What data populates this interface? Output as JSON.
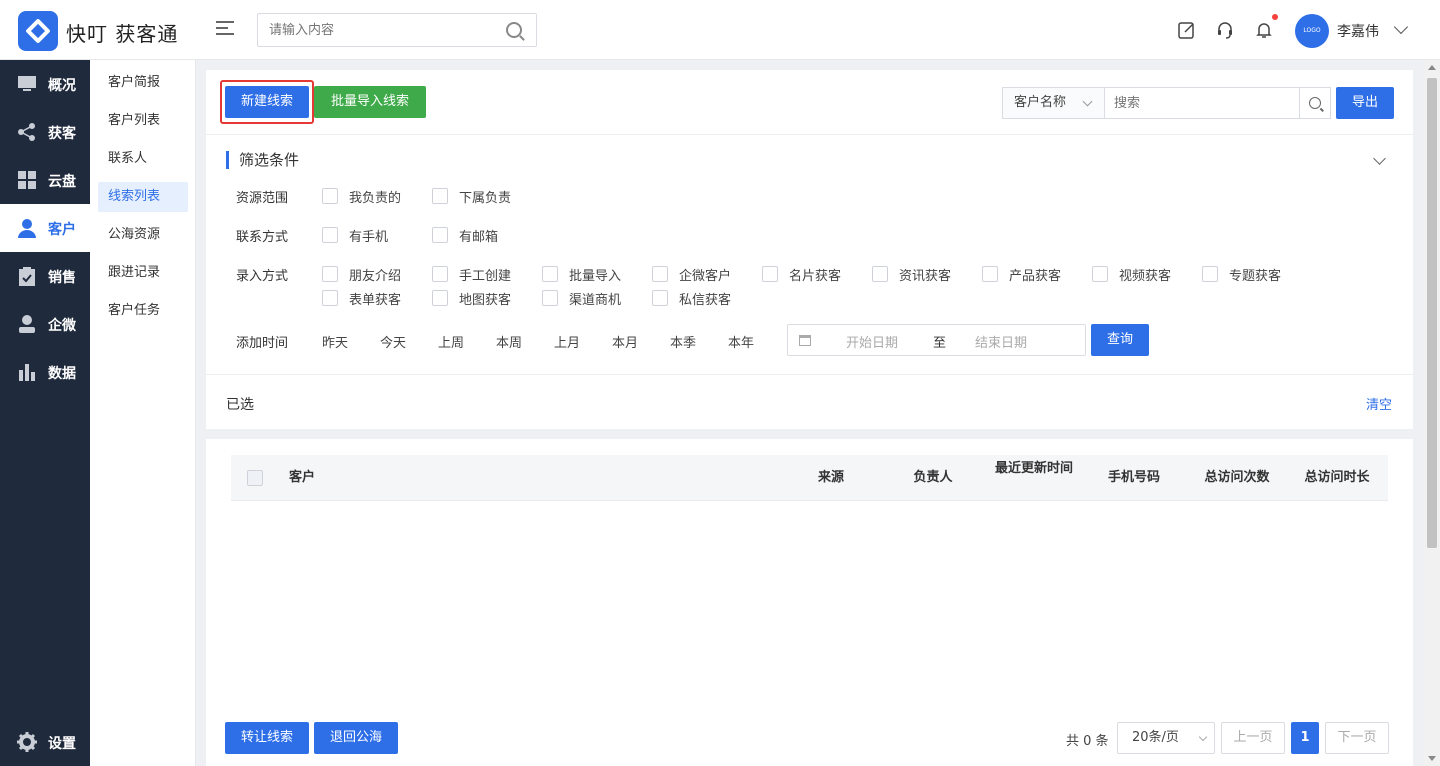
{
  "app": {
    "title": "快叮 获客通"
  },
  "header": {
    "search_placeholder": "请输入内容",
    "avatar_text": "LOGO",
    "username": "李嘉伟"
  },
  "nav": {
    "items": [
      {
        "label": "概况",
        "icon": "monitor-icon"
      },
      {
        "label": "获客",
        "icon": "share-icon"
      },
      {
        "label": "云盘",
        "icon": "grid-icon"
      },
      {
        "label": "客户",
        "icon": "user-icon",
        "active": true
      },
      {
        "label": "销售",
        "icon": "clipboard-check-icon"
      },
      {
        "label": "企微",
        "icon": "person-icon"
      },
      {
        "label": "数据",
        "icon": "bar-chart-icon"
      }
    ],
    "settings_label": "设置"
  },
  "subnav": {
    "items": [
      "客户简报",
      "客户列表",
      "联系人",
      "线索列表",
      "公海资源",
      "跟进记录",
      "客户任务"
    ],
    "active_index": 3
  },
  "toolbar": {
    "new_lead": "新建线索",
    "bulk_import": "批量导入线索",
    "field_select": "客户名称",
    "search_placeholder": "搜索",
    "export": "导出"
  },
  "filters": {
    "title": "筛选条件",
    "scope_label": "资源范围",
    "scope_options": [
      "我负责的",
      "下属负责"
    ],
    "contact_label": "联系方式",
    "contact_options": [
      "有手机",
      "有邮箱"
    ],
    "entry_label": "录入方式",
    "entry_options": [
      "朋友介绍",
      "手工创建",
      "批量导入",
      "企微客户",
      "名片获客",
      "资讯获客",
      "产品获客",
      "视频获客",
      "专题获客",
      "表单获客",
      "地图获客",
      "渠道商机",
      "私信获客"
    ],
    "time_label": "添加时间",
    "time_options": [
      "昨天",
      "今天",
      "上周",
      "本周",
      "上月",
      "本月",
      "本季",
      "本年"
    ],
    "start_placeholder": "开始日期",
    "range_sep": "至",
    "end_placeholder": "结束日期",
    "query": "查询"
  },
  "selected": {
    "label": "已选",
    "clear": "清空"
  },
  "table": {
    "columns": [
      "客户",
      "来源",
      "负责人",
      "最近更新时间",
      "手机号码",
      "总访问次数",
      "总访问时长"
    ]
  },
  "footer": {
    "transfer": "转让线索",
    "return_pool": "退回公海",
    "total": "共 0 条",
    "page_size": "20条/页",
    "prev": "上一页",
    "current_page": "1",
    "next": "下一页"
  },
  "colors": {
    "primary": "#2e6fe8",
    "green": "#3faa4a",
    "nav_bg": "#1f2a3d",
    "highlight": "#e53935"
  }
}
